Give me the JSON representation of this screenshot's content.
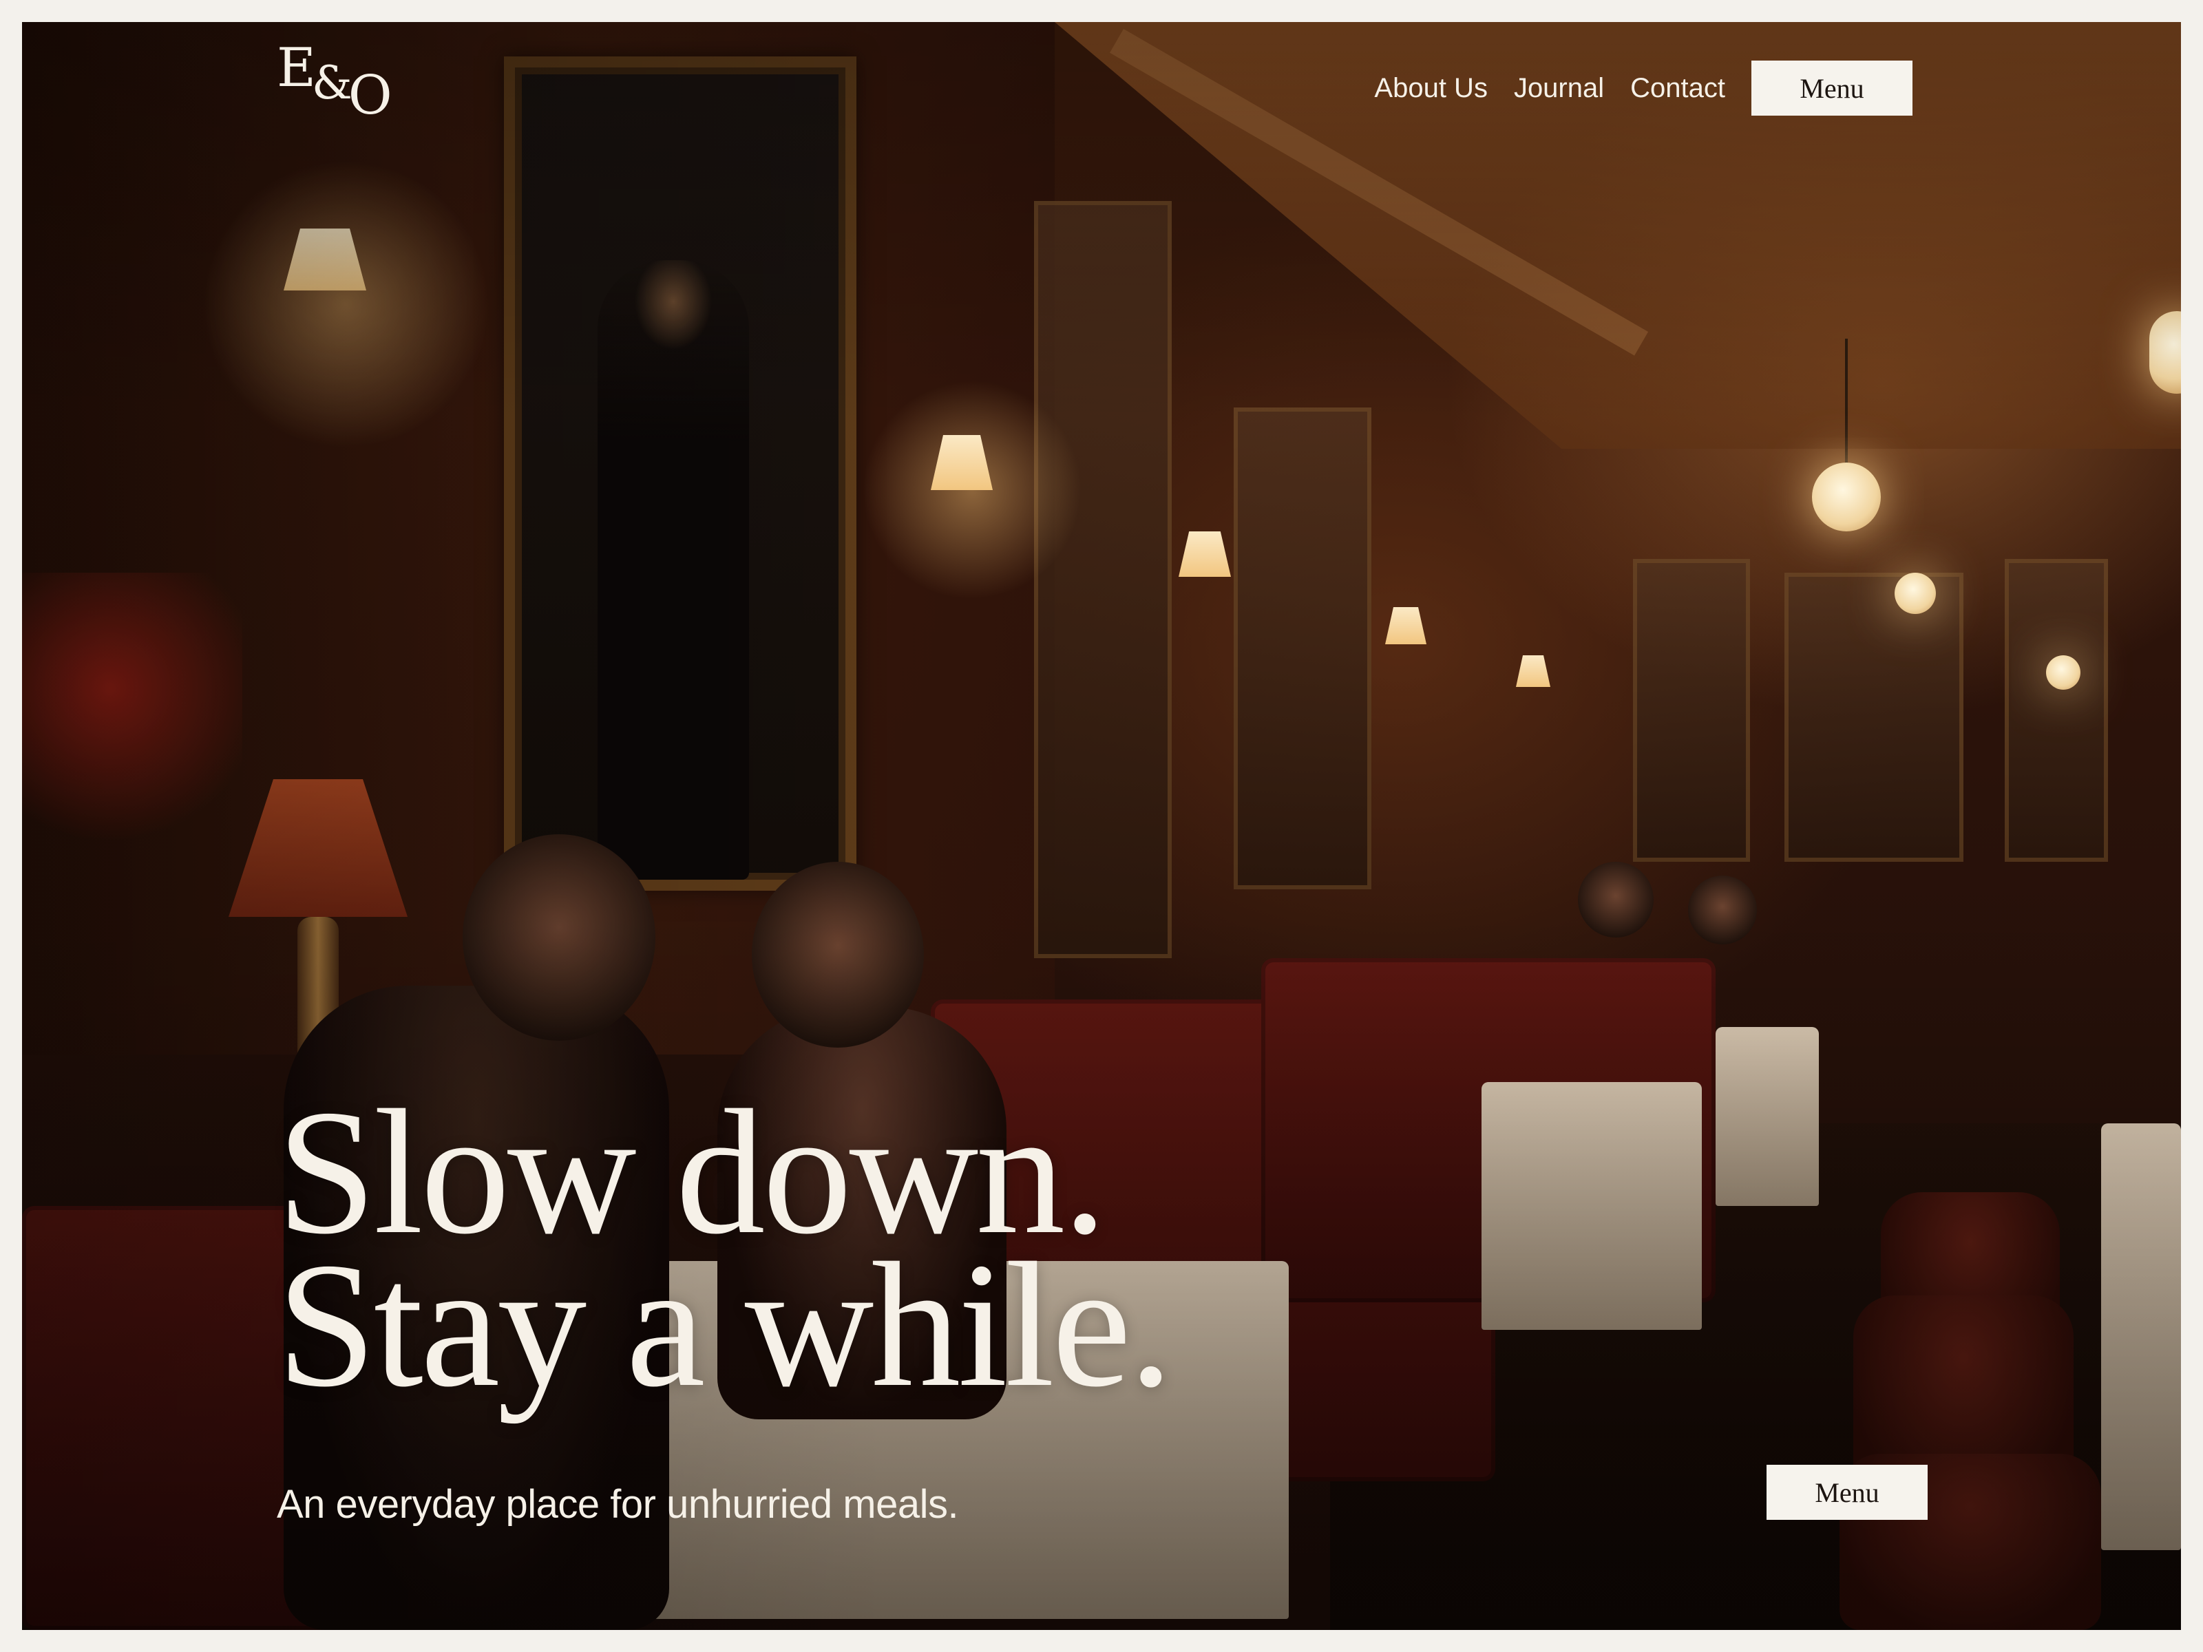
{
  "header": {
    "logo_text": "E&O",
    "logo_parts": [
      "E",
      "&",
      "O"
    ],
    "nav": {
      "about": "About Us",
      "journal": "Journal",
      "contact": "Contact"
    },
    "menu_button": "Menu"
  },
  "hero": {
    "headline_line1": "Slow down.",
    "headline_line2": "Stay a while.",
    "tagline": "An everyday place for unhurried meals.",
    "menu_button": "Menu"
  },
  "colors": {
    "page_border": "#f3f1ec",
    "text_light": "#f6f1e8",
    "button_bg": "#f6f3ed",
    "button_text": "#1c1410"
  }
}
